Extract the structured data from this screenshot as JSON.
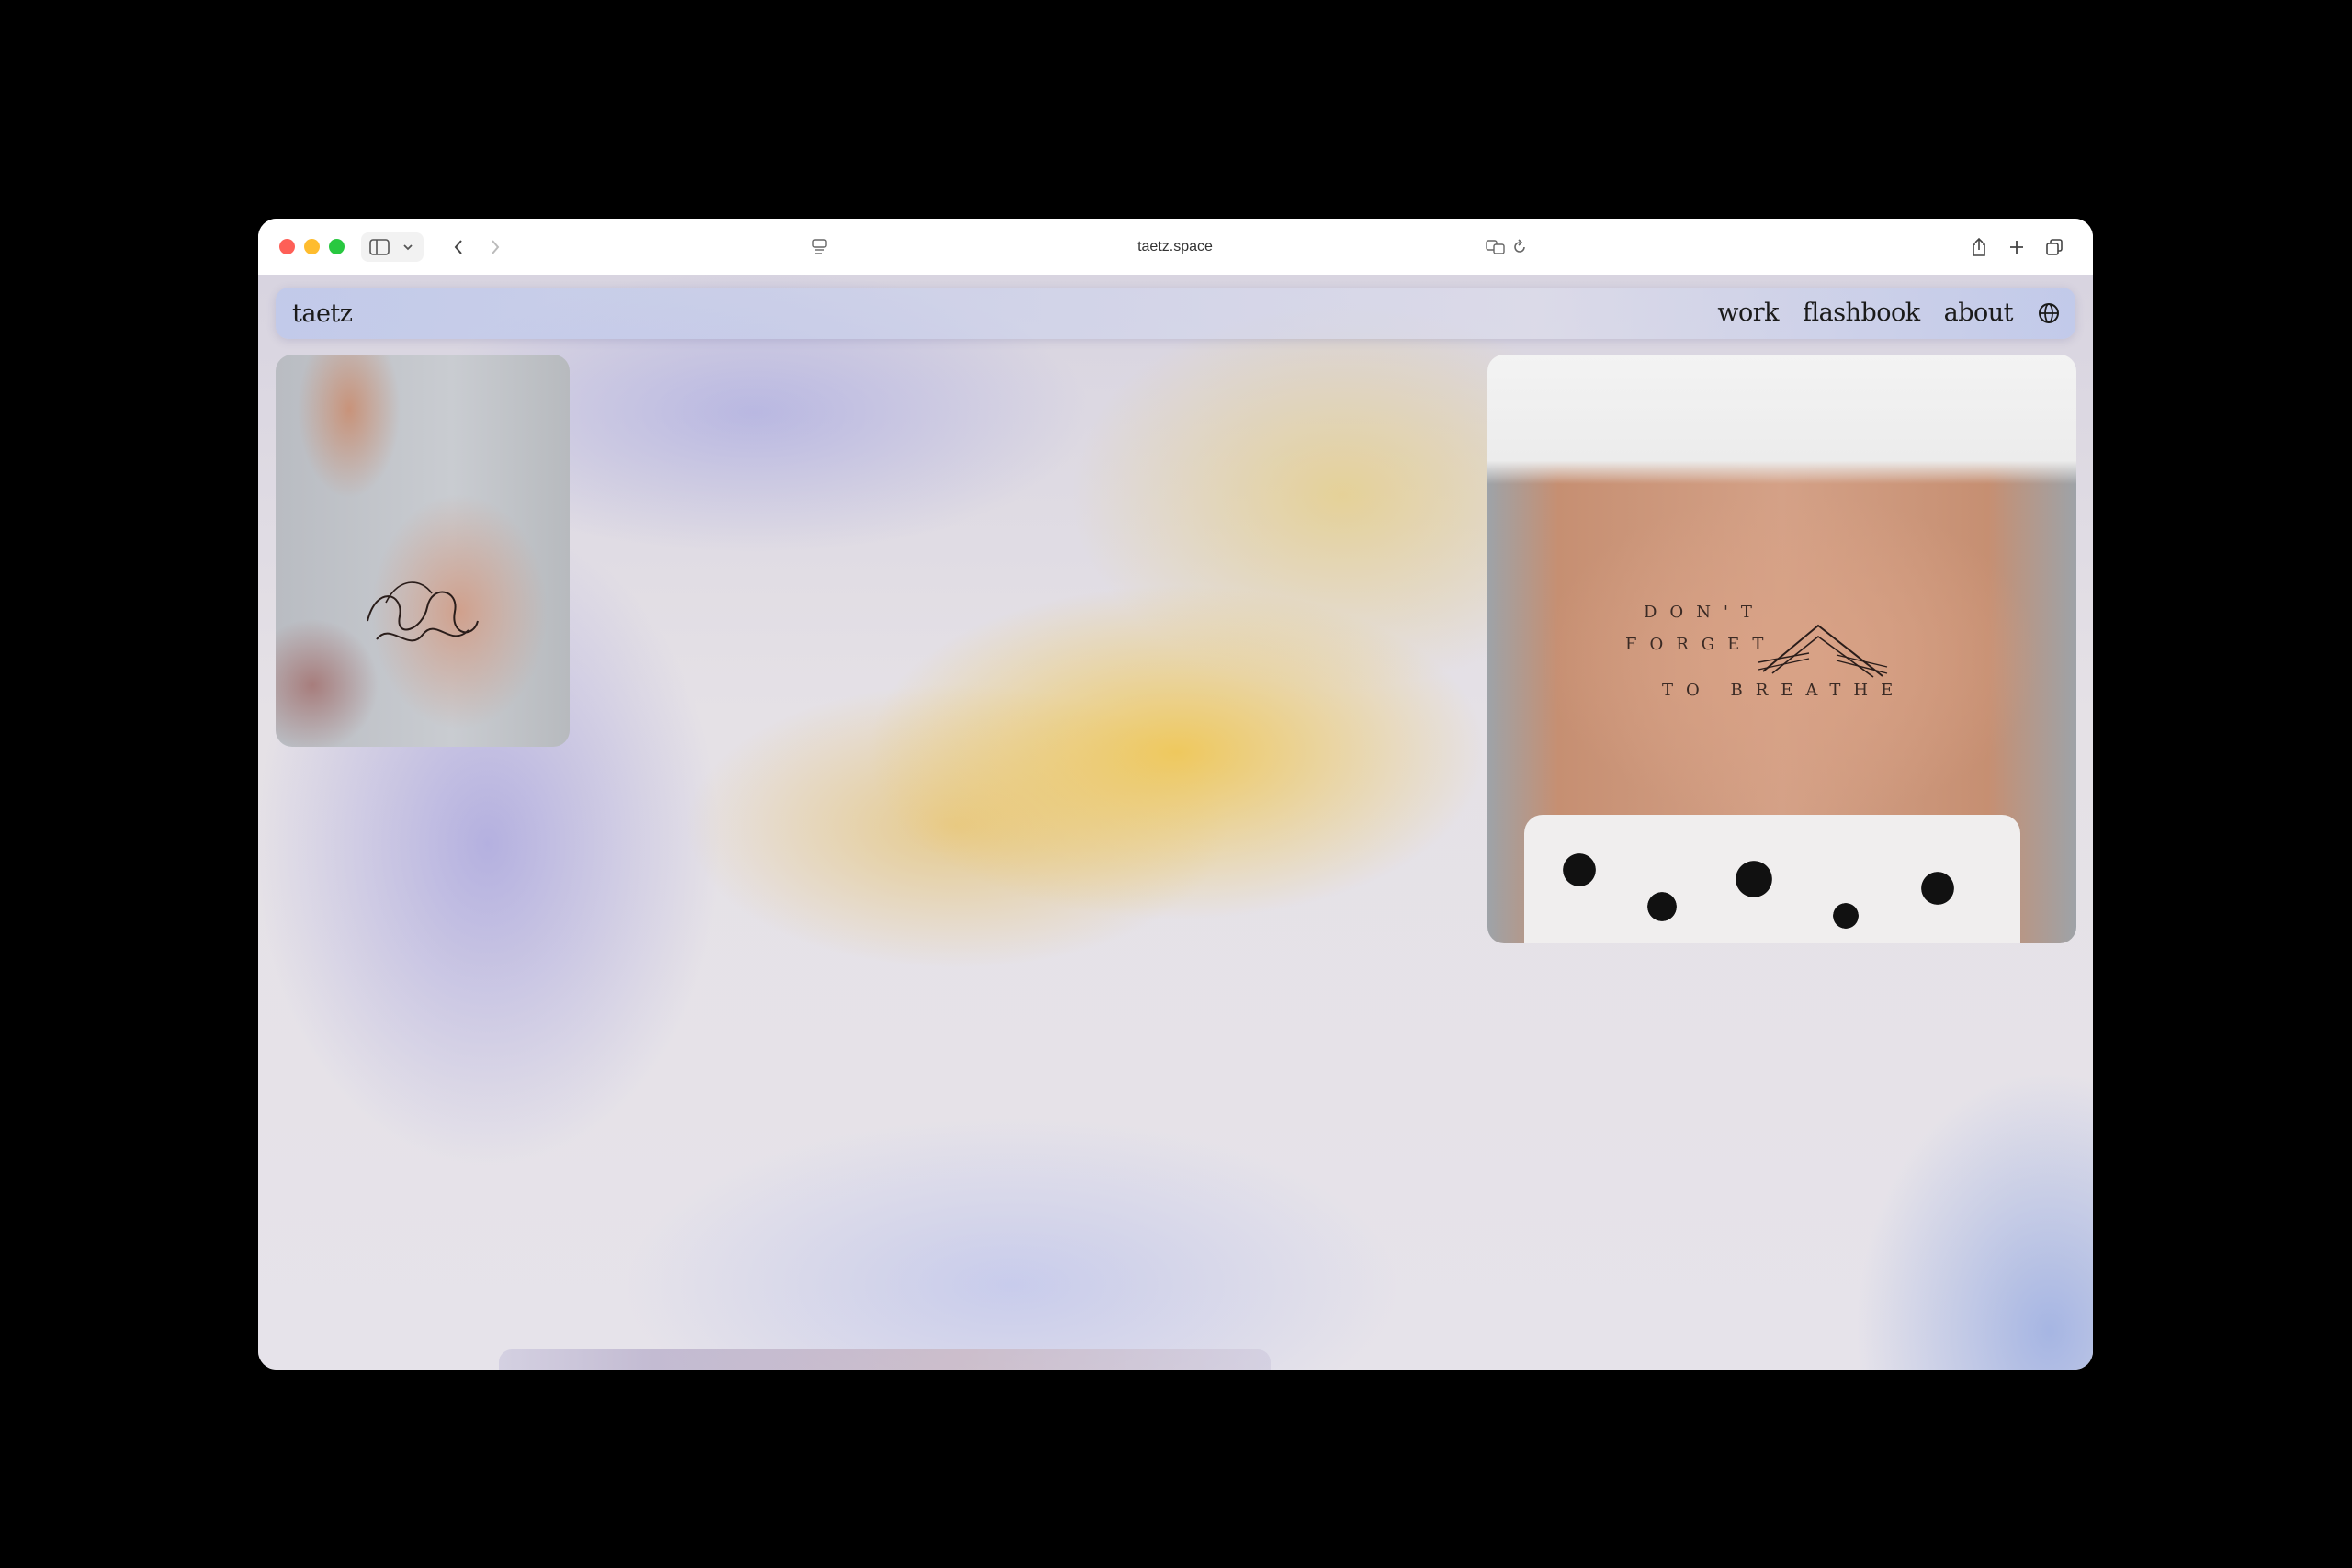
{
  "browser": {
    "url": "taetz.space",
    "icons": [
      "sidebar-icon",
      "chevron-down-icon",
      "back-icon",
      "forward-icon",
      "reader-icon",
      "translate-icon",
      "reload-icon",
      "share-icon",
      "plus-icon",
      "tabs-icon"
    ]
  },
  "site": {
    "logo": "taetz",
    "nav": {
      "work": "work",
      "flashbook": "flashbook",
      "about": "about"
    },
    "language_icon": "globe-icon"
  },
  "photos": {
    "belly_tattoo": {
      "line1": "DON'T",
      "line2": "FORGET",
      "line3": "TO  BREATHE"
    }
  },
  "colors": {
    "nav_text": "#1a1a1a",
    "accent_yellow": "#f0c446",
    "accent_lavender": "#a8a4de"
  }
}
